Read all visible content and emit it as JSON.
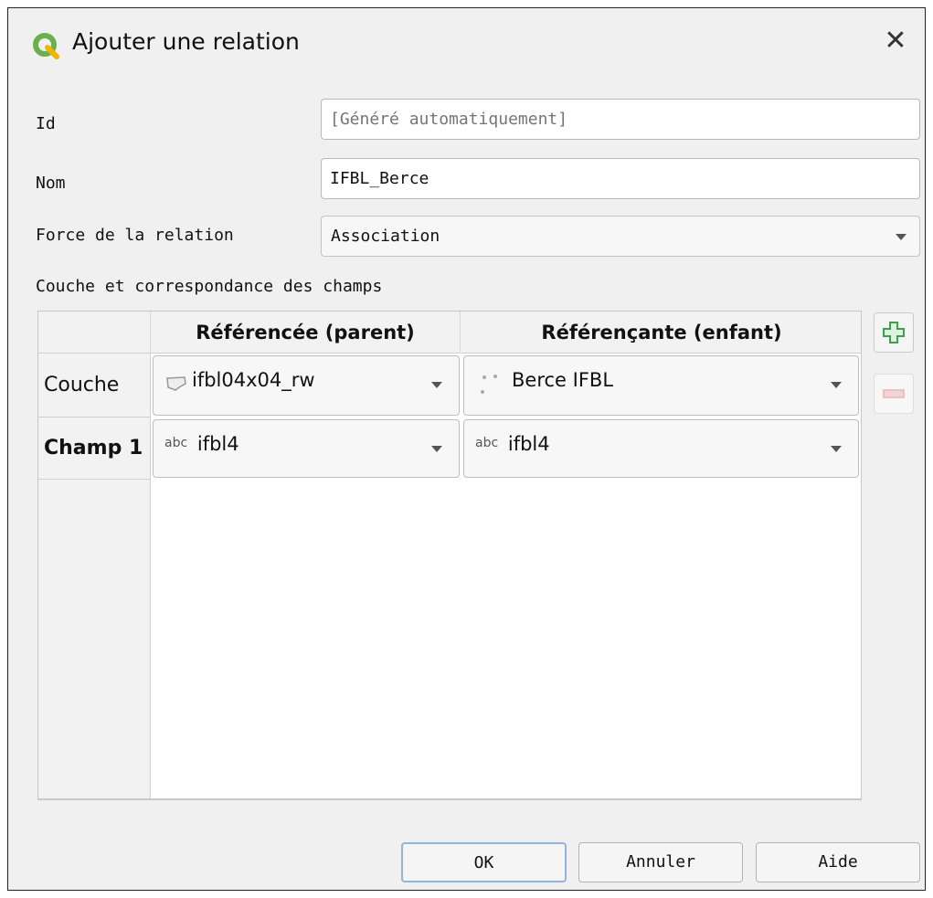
{
  "window": {
    "title": "Ajouter une relation"
  },
  "form": {
    "id_label": "Id",
    "id_placeholder": "[Généré automatiquement]",
    "name_label": "Nom",
    "name_value": "IFBL_Berce",
    "strength_label": "Force de la relation",
    "strength_value": "Association"
  },
  "section": {
    "title": "Couche et correspondance des champs"
  },
  "table": {
    "headers": {
      "parent": "Référencée (parent)",
      "child": "Référençante (enfant)"
    },
    "rows": [
      {
        "label": "Couche",
        "parent_icon": "polygon-layer-icon",
        "parent_value": "ifbl04x04_rw",
        "child_icon": "point-layer-icon",
        "child_value": "Berce IFBL"
      },
      {
        "label": "Champ 1",
        "parent_type": "abc",
        "parent_value": "ifbl4",
        "child_type": "abc",
        "child_value": "ifbl4"
      }
    ]
  },
  "buttons": {
    "ok": "OK",
    "cancel": "Annuler",
    "help": "Aide"
  },
  "colors": {
    "accent": "#8fb6da",
    "add_green": "#3aa14a",
    "logo_green": "#6ab04c"
  }
}
